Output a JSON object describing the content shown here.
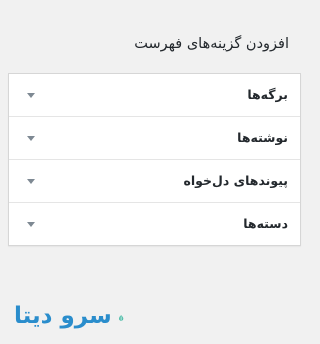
{
  "panel": {
    "title": "افزودن گزینه‌های فهرست"
  },
  "accordion": {
    "items": [
      {
        "label": "برگه‌ها"
      },
      {
        "label": "نوشته‌ها"
      },
      {
        "label": "پیوندهای دل‌خواه"
      },
      {
        "label": "دسته‌ها"
      }
    ]
  },
  "brand": {
    "name": "سرو دیتا",
    "icon": "cypress-tree-icon",
    "colors": {
      "text": "#2a8dcc",
      "icon_fill": "#3fb6a0"
    }
  }
}
